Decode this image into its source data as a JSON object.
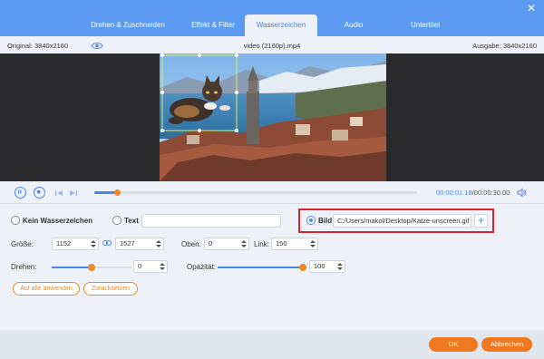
{
  "tabs": [
    {
      "label": "Drehen & Zuschneiden"
    },
    {
      "label": "Effekt & Filter"
    },
    {
      "label": "Wasserzeichen"
    },
    {
      "label": "Audio"
    },
    {
      "label": "Untertitel"
    }
  ],
  "active_tab": "Wasserzeichen",
  "info": {
    "original": "Original: 3840x2160",
    "file_name": "video (2160p).mp4",
    "output": "Ausgabe: 3840x2160"
  },
  "player": {
    "time_current": "00:00:01.18",
    "time_separator": "/",
    "time_total": "00:00:30.00",
    "progress_fraction": 0.07
  },
  "watermark": {
    "none_label": "Kein Wasserzeichen",
    "text_label": "Text",
    "text_value": "",
    "image_label": "Bild",
    "image_path": "C:/Users/makol/Desktop/Katze-unscreen.gif",
    "selected": "Bild"
  },
  "size": {
    "label": "Größe:",
    "width": "1152",
    "height": "1527"
  },
  "position": {
    "top_label": "Oben:",
    "top_value": "0",
    "left_label": "Link:",
    "left_value": "150"
  },
  "rotate": {
    "label": "Drehen:",
    "value": "0",
    "fraction": 0.5
  },
  "opacity": {
    "label": "Opazität:",
    "value": "100",
    "fraction": 1.0
  },
  "buttons": {
    "apply_all": "Auf alle anwenden",
    "reset": "Zurücksetzen",
    "ok": "OK",
    "cancel": "Abbrechen"
  },
  "icons": {
    "close": "close-icon",
    "eye": "eye-icon",
    "play": "play-icon",
    "stop": "stop-icon",
    "prev": "previous-frame-icon",
    "next": "next-frame-icon",
    "volume": "volume-icon",
    "link": "link-icon",
    "plus": "plus-icon"
  },
  "colors": {
    "header": "#5a9bf1",
    "accent": "#4a86e8",
    "orange": "#f08a24",
    "highlight_border": "#d9232e"
  }
}
